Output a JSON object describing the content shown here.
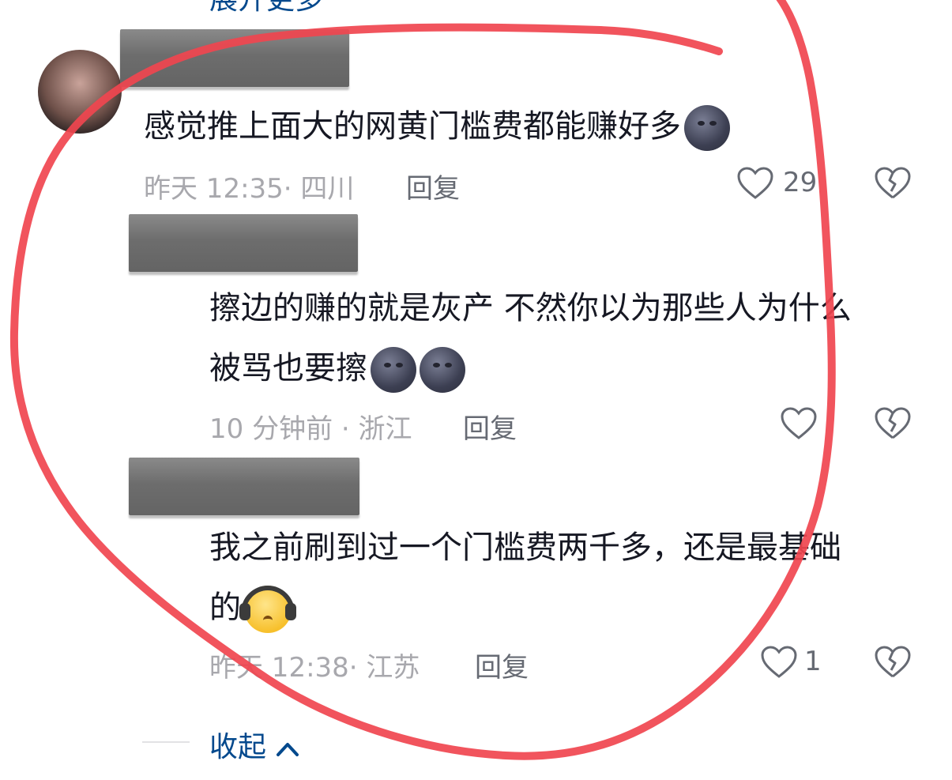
{
  "top_partial": {
    "text": "展开更多"
  },
  "comments": [
    {
      "text": "感觉推上面大的网黄门槛费都能赚好多",
      "emoji": [
        "new-moon-face"
      ],
      "time": "昨天 12:35",
      "location": "四川",
      "reply_label": "回复",
      "like_count": "29"
    },
    {
      "lines": [
        "擦边的赚的就是灰产 不然你以为那些人为什么",
        "被骂也要擦"
      ],
      "emoji": [
        "new-moon-face",
        "new-moon-face"
      ],
      "time": "10 分钟前",
      "location": "浙江",
      "reply_label": "回复",
      "like_count": ""
    },
    {
      "lines": [
        "我之前刷到过一个门槛费两千多，还是最基础",
        "的"
      ],
      "emoji": [
        "face-with-headphones"
      ],
      "time": "昨天 12:38",
      "location": "江苏",
      "reply_label": "回复",
      "like_count": "1"
    }
  ],
  "collapse_label": "收起",
  "annotation_color": "#f0454f",
  "accent_color": "#04498d"
}
